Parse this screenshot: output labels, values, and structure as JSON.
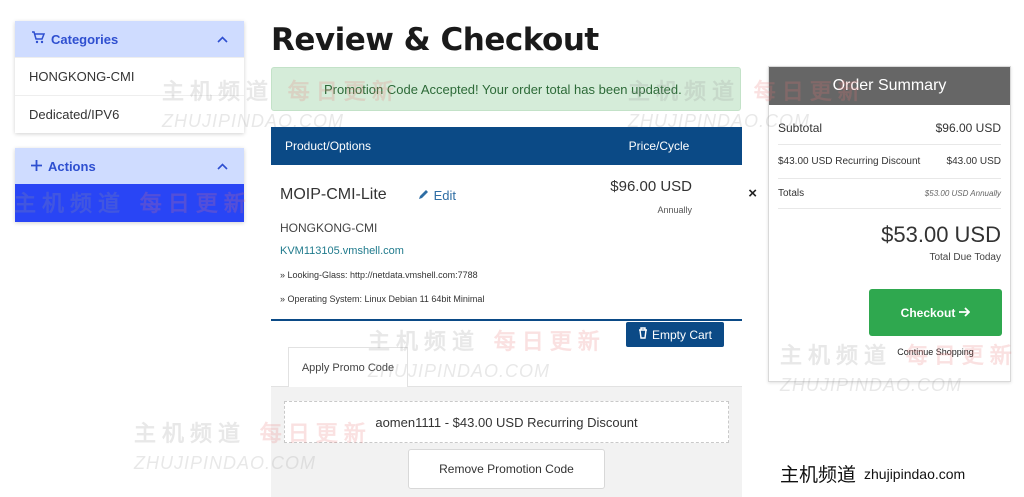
{
  "sidebar": {
    "categories": {
      "title": "Categories",
      "icon": "cart-icon",
      "items": [
        {
          "label": "HONGKONG-CMI"
        },
        {
          "label": "Dedicated/IPV6"
        }
      ]
    },
    "actions": {
      "title": "Actions",
      "icon": "plus-icon"
    }
  },
  "page": {
    "title": "Review & Checkout",
    "alert": "Promotion Code Accepted! Your order total has been updated."
  },
  "cart": {
    "headers": {
      "product": "Product/Options",
      "price": "Price/Cycle"
    },
    "item": {
      "name": "MOIP-CMI-Lite",
      "edit": "Edit",
      "group": "HONGKONG-CMI",
      "domain": "KVM113105.vmshell.com",
      "options": [
        "» Looking-Glass: http://netdata.vmshell.com:7788",
        "» Operating System: Linux Debian 11 64bit Minimal"
      ],
      "price": "$96.00 USD",
      "cycle": "Annually",
      "remove": "×"
    },
    "empty_cart": "Empty Cart"
  },
  "promo": {
    "tab": "Apply Promo Code",
    "applied": "aomen1111 - $43.00 USD Recurring Discount",
    "remove": "Remove Promotion Code"
  },
  "summary": {
    "title": "Order Summary",
    "subtotal_label": "Subtotal",
    "subtotal_value": "$96.00 USD",
    "discount_label": "$43.00 USD Recurring Discount",
    "discount_value": "$43.00 USD",
    "totals_label": "Totals",
    "totals_value": "$53.00 USD Annually",
    "total_big": "$53.00 USD",
    "total_due": "Total Due Today",
    "checkout": "Checkout",
    "continue": "Continue Shopping"
  },
  "watermark": {
    "cn_gray": "主机频道",
    "cn_red": "每日更新",
    "en": "ZHUJIPINDAO.COM",
    "badge_cn": "主机频道",
    "badge_en": "zhujipindao.com"
  }
}
